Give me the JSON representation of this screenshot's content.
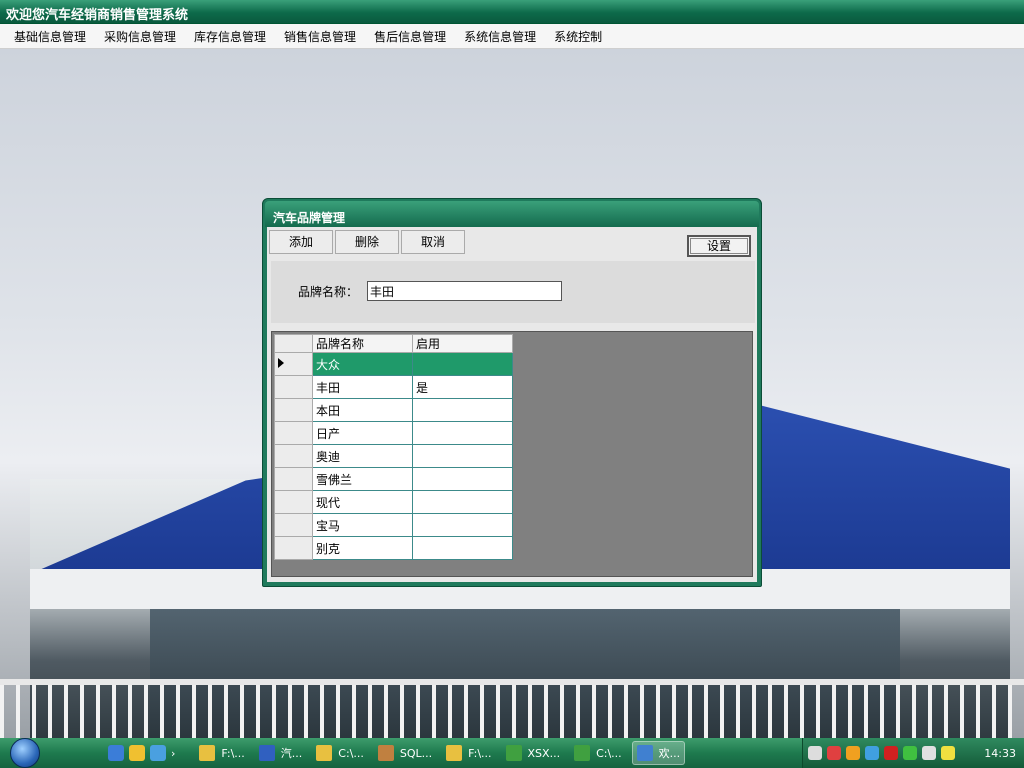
{
  "window": {
    "title": "欢迎您汽车经销商销售管理系统"
  },
  "menu": [
    "基础信息管理",
    "采购信息管理",
    "库存信息管理",
    "销售信息管理",
    "售后信息管理",
    "系统信息管理",
    "系统控制"
  ],
  "dialog": {
    "title": "汽车品牌管理",
    "toolbar": {
      "add": "添加",
      "delete": "删除",
      "cancel": "取消"
    },
    "settings": "设置",
    "form": {
      "brand_label": "品牌名称：",
      "brand_value": "丰田"
    },
    "grid": {
      "columns": [
        "品牌名称",
        "启用"
      ],
      "rows": [
        {
          "name": "大众",
          "enabled": ""
        },
        {
          "name": "丰田",
          "enabled": "是"
        },
        {
          "name": "本田",
          "enabled": ""
        },
        {
          "name": "日产",
          "enabled": ""
        },
        {
          "name": "奥迪",
          "enabled": ""
        },
        {
          "name": "雪佛兰",
          "enabled": ""
        },
        {
          "name": "现代",
          "enabled": ""
        },
        {
          "name": "宝马",
          "enabled": ""
        },
        {
          "name": "别克",
          "enabled": ""
        }
      ],
      "selected_index": 0
    }
  },
  "taskbar": {
    "items": [
      "F:\\...",
      "汽...",
      "C:\\...",
      "SQL...",
      "F:\\...",
      "XSX...",
      "C:\\...",
      "欢..."
    ],
    "active_index": 7,
    "clock": "14:33"
  },
  "colors": {
    "titlebar": "#0d6a4a",
    "selection": "#1f9a6a",
    "taskbar": "#1e7a4e"
  }
}
